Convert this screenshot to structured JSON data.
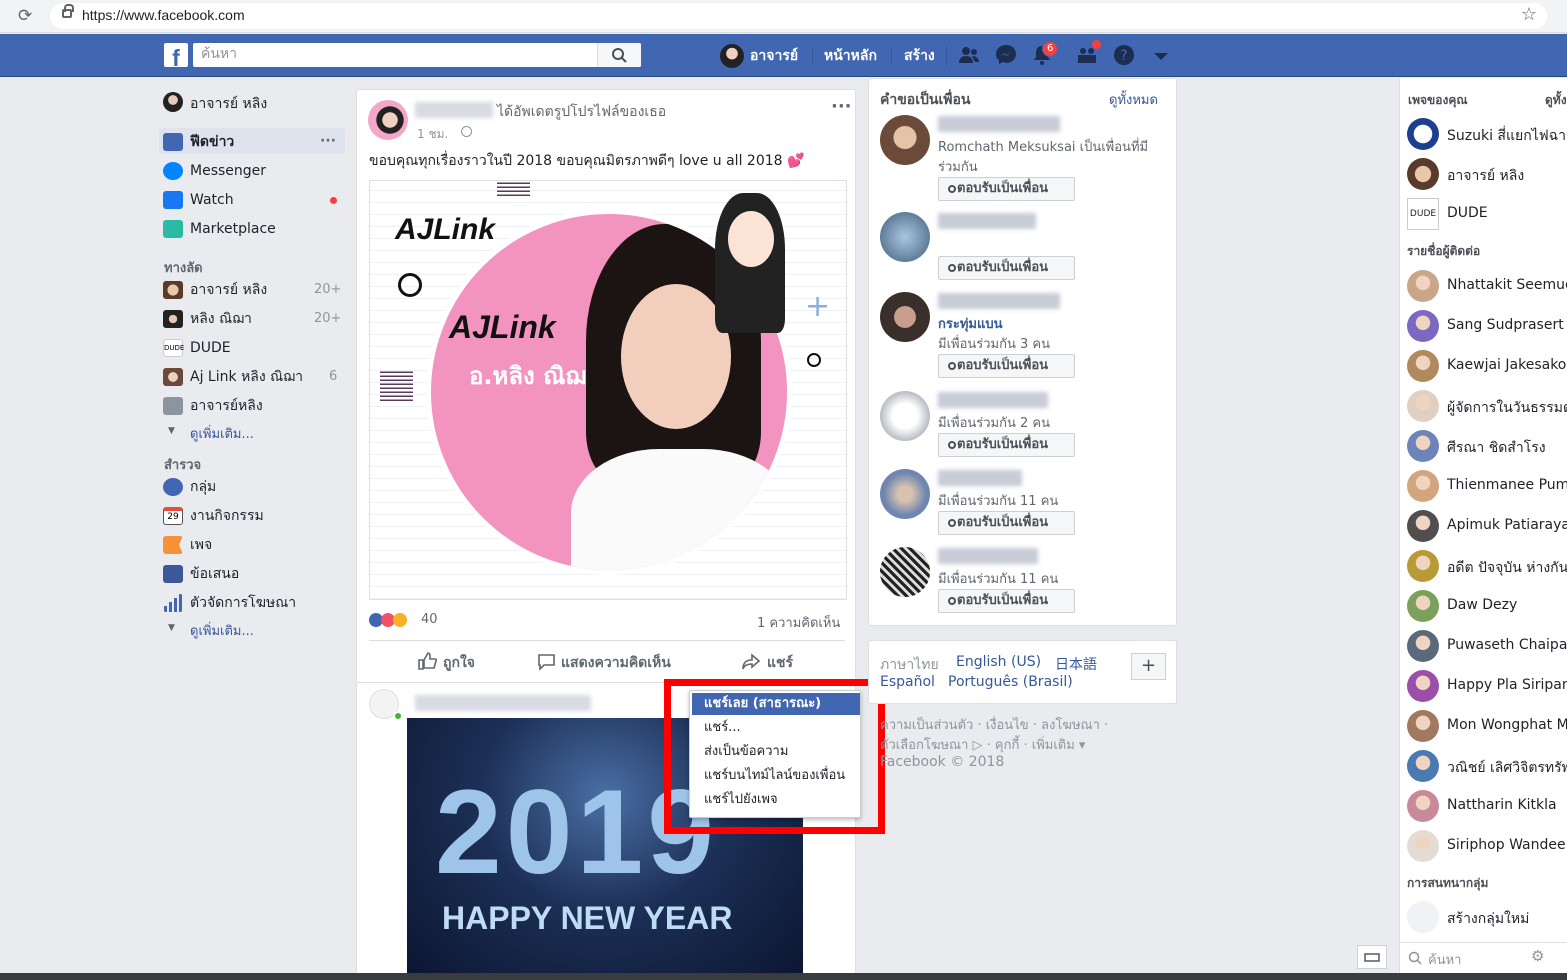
{
  "browser": {
    "url": "https://www.facebook.com"
  },
  "header": {
    "search_placeholder": "ค้นหา",
    "profile_name": "อาจารย์",
    "home_label": "หน้าหลัก",
    "create_label": "สร้าง",
    "notification_count": "6"
  },
  "left_nav": {
    "profile_name": "อาจารย์ หลิง",
    "main_items": [
      {
        "label": "ฟีดข่าว",
        "icon": "news-feed-icon"
      },
      {
        "label": "Messenger",
        "icon": "messenger-icon"
      },
      {
        "label": "Watch",
        "icon": "watch-icon"
      },
      {
        "label": "Marketplace",
        "icon": "marketplace-icon"
      }
    ],
    "shortcuts_heading": "ทางลัด",
    "shortcuts": [
      {
        "label": "อาจารย์ หลิง",
        "count": "20+"
      },
      {
        "label": "หลิง ณิฌา",
        "count": "20+"
      },
      {
        "label": "DUDE",
        "count": ""
      },
      {
        "label": "Aj Link หลิง ณิฌา",
        "count": "6"
      },
      {
        "label": "อาจารย์หลิง",
        "count": ""
      }
    ],
    "see_more": "ดูเพิ่มเติม...",
    "explore_heading": "สำรวจ",
    "explore": [
      {
        "label": "กลุ่ม",
        "icon": "groups-icon"
      },
      {
        "label": "งานกิจกรรม",
        "icon": "calendar-icon"
      },
      {
        "label": "เพจ",
        "icon": "flag-icon"
      },
      {
        "label": "ข้อเสนอ",
        "icon": "offers-icon"
      },
      {
        "label": "ตัวจัดการโฆษณา",
        "icon": "ads-manager-icon"
      }
    ],
    "calendar_day": "29"
  },
  "post": {
    "action_text": "ได้อัพเดตรูปโปรไฟล์ของเธอ",
    "time": "1 ชม.",
    "message": "ขอบคุณทุกเรื่องราวในปี 2018 ขอบคุณมิตรภาพดีๆ love u all 2018 💕",
    "image_brand": "AJLink",
    "image_subtitle": "อ.หลิง ณิฌา",
    "reaction_count": "40",
    "comment_count": "1 ความคิดเห็น",
    "like_label": "ถูกใจ",
    "comment_label": "แสดงความคิดเห็น",
    "share_label": "แชร์"
  },
  "share_menu": {
    "items": [
      "แชร์เลย (สาธารณะ)",
      "แชร์...",
      "ส่งเป็นข้อความ",
      "แชร์บนไทม์ไลน์ของเพื่อน",
      "แชร์ไปยังเพจ"
    ]
  },
  "post2": {
    "image_year": "2019",
    "image_caption": "HAPPY NEW YEAR"
  },
  "friend_requests": {
    "heading": "คำขอเป็นเพื่อน",
    "see_all": "ดูทั้งหมด",
    "confirm_label": "ตอบรับเป็นเพื่อน",
    "items": [
      {
        "subtitle_1": "Romchath Meksuksai เป็นเพื่อนที่มี",
        "subtitle_2": "ร่วมกัน"
      },
      {
        "subtitle_1": "",
        "subtitle_2": ""
      },
      {
        "subtitle_1": "กระทุ่มแบน",
        "subtitle_2": "มีเพื่อนร่วมกัน 3 คน"
      },
      {
        "subtitle_1": "มีเพื่อนร่วมกัน 2 คน",
        "subtitle_2": ""
      },
      {
        "subtitle_1": "มีเพื่อนร่วมกัน 11 คน",
        "subtitle_2": ""
      },
      {
        "subtitle_1": "มีเพื่อนร่วมกัน 11 คน",
        "subtitle_2": ""
      }
    ]
  },
  "languages": {
    "current": "ภาษาไทย",
    "options": [
      "English (US)",
      "日本語",
      "Español",
      "Português (Brasil)"
    ]
  },
  "footer": {
    "line1": "ความเป็นส่วนตัว · เงื่อนไข · ลงโฆษณา ·",
    "line2": "ตัวเลือกโฆษณา ▷ · คุกกี้ · เพิ่มเติม ▾",
    "copyright": "Facebook © 2018"
  },
  "chat_sidebar": {
    "pages_heading": "เพจของคุณ",
    "pages_more": "ดูทั้ง",
    "pages": [
      "Suzuki สี่แยกไฟฉาย",
      "อาจารย์ หลิง",
      "DUDE"
    ],
    "contacts_heading": "รายชื่อผู้ติดต่อ",
    "contacts": [
      "Nhattakit Seemued",
      "Sang Sudprasert",
      "Kaewjai Jakesakoon",
      "ผู้จัดการในวันธรรมด...",
      "ศีรณา ชิดสำโรง",
      "Thienmanee Pum...",
      "Apimuk Patiarayakul",
      "อดีต ปัจจุบัน ห่างกัน...",
      "Daw Dezy",
      "Puwaseth Chaipa...",
      "Happy Pla Siripanya",
      "Mon Wongphat M...",
      "วณิชย์ เลิศวิจิตรทรัพย์",
      "Nattharin Kitkla",
      "Siriphop Wandee"
    ],
    "group_heading": "การสนทนากลุ่ม",
    "create_group": "สร้างกลุ่มใหม่",
    "search_placeholder": "ค้นหา"
  }
}
